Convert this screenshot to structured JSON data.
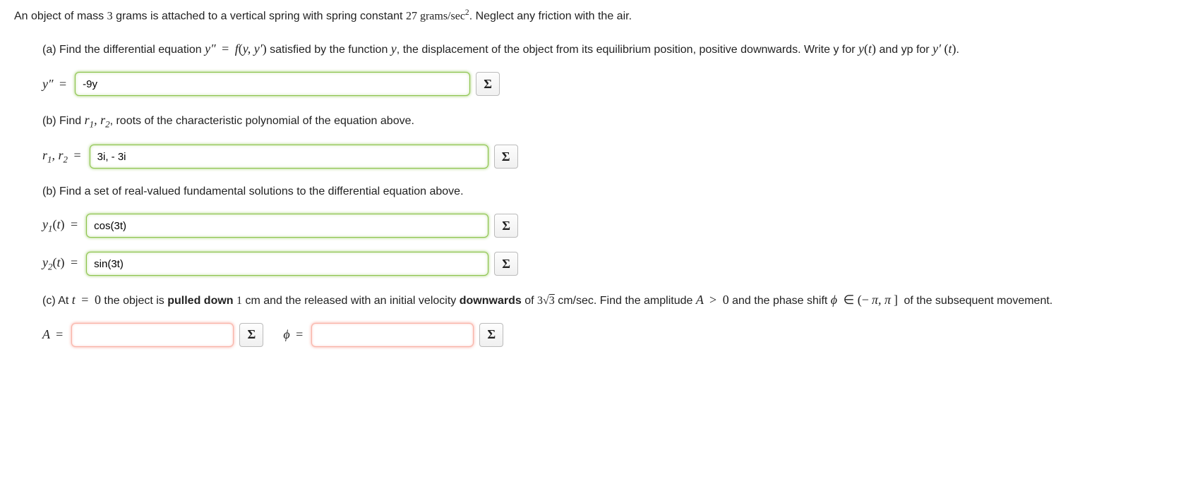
{
  "intro_prefix": "An object of mass ",
  "mass": "3",
  "intro_mid1": " grams is attached to a vertical spring with spring constant ",
  "k": "27",
  "units_k": " grams/sec",
  "intro_tail": ". Neglect any friction with the air.",
  "partA": {
    "prefix": "(a) Find the differential equation ",
    "mid1": " satisfied by the function ",
    "mid2": ", the displacement of the object from its equilibrium position, positive downwards. Write y for ",
    "mid3": " and yp for ",
    "tail": ".",
    "label_lhs": "y″",
    "value": "-9y"
  },
  "partB1": {
    "text_prefix": "(b) Find ",
    "text_tail": ", roots of the characteristic polynomial of the equation above.",
    "label": "r₁, r₂",
    "value": "3i, - 3i"
  },
  "partB2": {
    "text": "(b) Find a set of real-valued fundamental solutions to the differential equation above.",
    "y1_label_pre": "y",
    "y1_label_sub": "1",
    "y1_value": "cos(3t)",
    "y2_label_sub": "2",
    "y2_value": "sin(3t)"
  },
  "partC": {
    "prefix": "(c) At ",
    "seg1": " the object is ",
    "bold1": "pulled down",
    "seg2": " cm and the released with an initial velocity ",
    "bold2": "downwards",
    "seg3": " of ",
    "seg4": " cm/sec. Find the amplitude ",
    "seg5": " and the phase shift ",
    "seg6": " of the subsequent movement.",
    "A_value": "",
    "phi_value": ""
  },
  "sigma": "Σ"
}
